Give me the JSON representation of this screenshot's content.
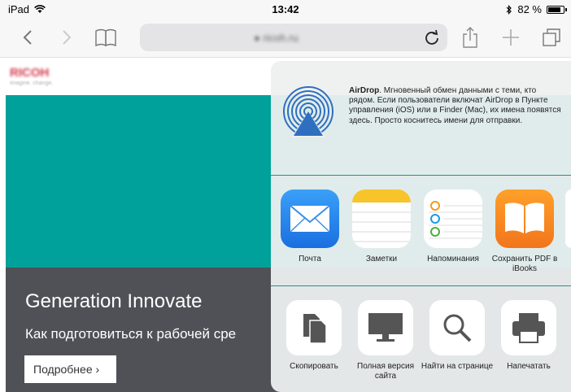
{
  "status_bar": {
    "device": "iPad",
    "time": "13:42",
    "battery_percent": "82 %",
    "battery_level": 0.82
  },
  "toolbar": {
    "back_icon": "chevron-left-icon",
    "forward_icon": "chevron-right-icon",
    "bookmarks_icon": "book-icon",
    "url": "● ricoh.ru",
    "reload_icon": "reload-icon",
    "share_icon": "share-icon",
    "add_icon": "plus-icon",
    "tabs_icon": "tabs-icon"
  },
  "page": {
    "logo": "RICOH",
    "logo_sub": "imagine. change.",
    "hero_title": "Generation Innovate",
    "hero_subtitle": "Как подготовиться к рабочей сре",
    "hero_button": "Подробнее ›",
    "colors": {
      "teal": "#00a19a",
      "hero_bg": "#4f5157"
    }
  },
  "share_sheet": {
    "airdrop_title": "AirDrop",
    "airdrop_text": ". Мгновенный обмен данными с теми, кто рядом. Если пользователи включат AirDrop в Пункте управления (iOS) или в Finder (Mac), их имена появятся здесь. Просто коснитесь имени для отправки.",
    "apps": [
      {
        "label": "Почта",
        "icon": "mail-icon"
      },
      {
        "label": "Заметки",
        "icon": "notes-icon"
      },
      {
        "label": "Напоминания",
        "icon": "reminders-icon"
      },
      {
        "label": "Сохранить PDF в iBooks",
        "icon": "ibooks-icon"
      }
    ],
    "actions": [
      {
        "label": "Скопировать",
        "icon": "copy-icon"
      },
      {
        "label": "Полная версия сайта",
        "icon": "desktop-icon"
      },
      {
        "label": "Найти на странице",
        "icon": "search-icon"
      },
      {
        "label": "Напечатать",
        "icon": "print-icon"
      }
    ]
  }
}
